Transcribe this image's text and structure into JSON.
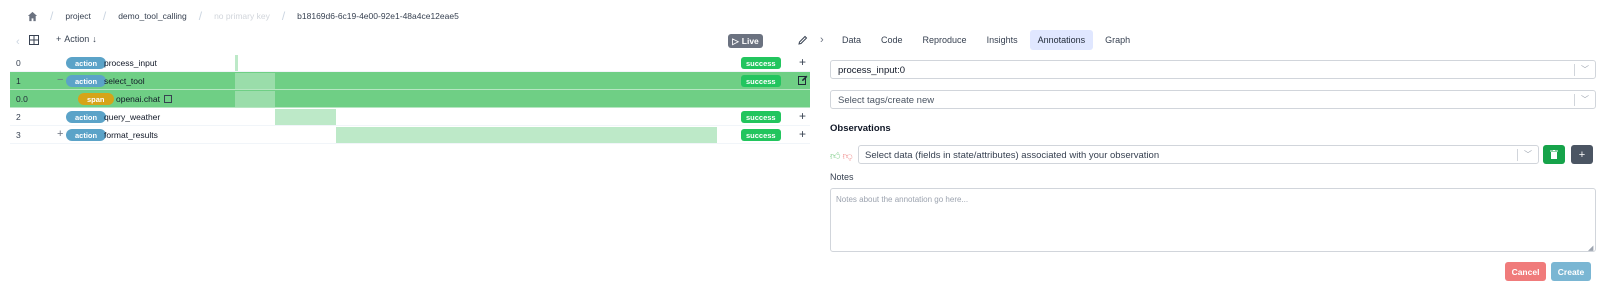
{
  "breadcrumb": {
    "home_icon": "home-icon",
    "items": [
      "project",
      "demo_tool_calling",
      "no primary key",
      "b18169d6-6c19-4e00-92e1-48a4ce12eae5"
    ]
  },
  "toolbar": {
    "add_label": "Action",
    "live_label": "Live"
  },
  "steps": [
    {
      "index": "0",
      "type": "action",
      "name": "process_input",
      "status": "success",
      "expand": ""
    },
    {
      "index": "1",
      "type": "action",
      "name": "select_tool",
      "status": "success",
      "expand": "−"
    },
    {
      "index": "0.0",
      "type": "span",
      "name": "openai.chat",
      "status": "",
      "expand": ""
    },
    {
      "index": "2",
      "type": "action",
      "name": "query_weather",
      "status": "success",
      "expand": ""
    },
    {
      "index": "3",
      "type": "action",
      "name": "format_results",
      "status": "success",
      "expand": "+"
    }
  ],
  "tabs": [
    "Data",
    "Code",
    "Reproduce",
    "Insights",
    "Annotations",
    "Graph"
  ],
  "active_tab": "Annotations",
  "annotation": {
    "step_value": "process_input:0",
    "tags_placeholder": "Select tags/create new",
    "observations_heading": "Observations",
    "observation_placeholder": "Select data (fields in state/attributes) associated with your observation",
    "notes_heading": "Notes",
    "notes_placeholder": "Notes about the annotation go here...",
    "cancel_label": "Cancel",
    "create_label": "Create"
  },
  "colors": {
    "selected_row": "#6fcf85",
    "action_badge": "#5ba3c8",
    "span_badge": "#d6a418",
    "success": "#22c55e",
    "cancel": "#f07b7b",
    "create": "#7ab6d3"
  }
}
